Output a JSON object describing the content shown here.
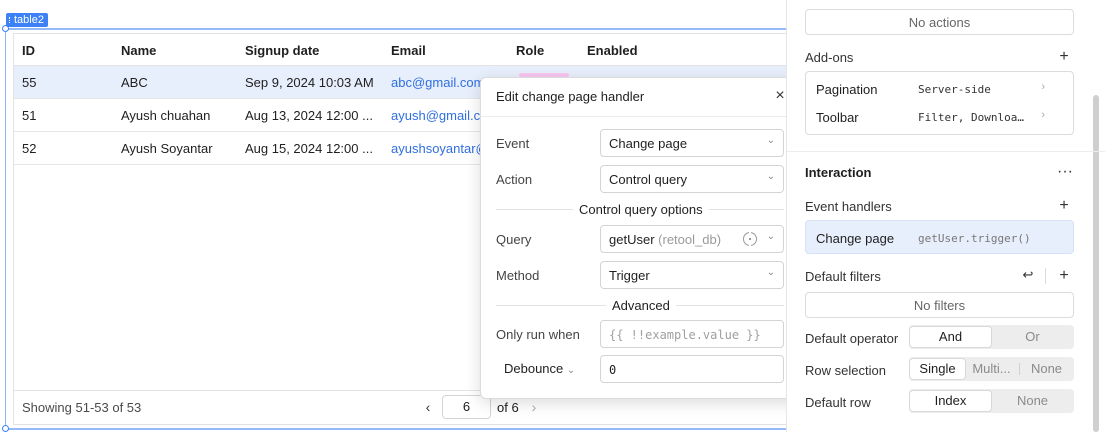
{
  "component_tag": "table2",
  "table": {
    "columns": [
      "ID",
      "Name",
      "Signup date",
      "Email",
      "Role",
      "Enabled"
    ],
    "rows": [
      {
        "id": "55",
        "name": "ABC",
        "signup": "Sep 9, 2024 10:03 AM",
        "email": "abc@gmail.com"
      },
      {
        "id": "51",
        "name": "Ayush chuahan",
        "signup": "Aug 13, 2024 12:00 ...",
        "email": "ayush@gmail.co"
      },
      {
        "id": "52",
        "name": "Ayush Soyantar",
        "signup": "Aug 15, 2024 12:00 ...",
        "email": "ayushsoyantar@"
      }
    ],
    "footer": {
      "showing": "Showing 51-53 of 53",
      "prev_icon": "‹",
      "page_value": "6",
      "of_total": "of 6",
      "next_icon": "›"
    }
  },
  "modal": {
    "title": "Edit change page handler",
    "close_icon": "×",
    "event_label": "Event",
    "event_value": "Change page",
    "action_label": "Action",
    "action_value": "Control query",
    "section_control": "Control query options",
    "query_label": "Query",
    "query_value": "getUser",
    "query_source": "(retool_db)",
    "method_label": "Method",
    "method_value": "Trigger",
    "section_advanced": "Advanced",
    "only_run_label": "Only run when",
    "only_run_placeholder": "{{ !!example.value }}",
    "debounce_label": "Debounce",
    "debounce_value": "0",
    "chevron_icon": "⌄"
  },
  "panel": {
    "actions_empty": "No actions",
    "addons_title": "Add-ons",
    "addons": [
      {
        "label": "Pagination",
        "value": "Server-side"
      },
      {
        "label": "Toolbar",
        "value": "Filter, Downloa…"
      }
    ],
    "interaction_title": "Interaction",
    "more_icon": "···",
    "event_handlers_title": "Event handlers",
    "event_handler": {
      "label": "Change page",
      "value": "getUser.trigger()"
    },
    "default_filters_title": "Default filters",
    "filters_empty": "No filters",
    "default_operator_label": "Default operator",
    "operator_options": [
      "And",
      "Or"
    ],
    "row_selection_label": "Row selection",
    "row_selection_options": [
      "Single",
      "Multi...",
      "None"
    ],
    "default_row_label": "Default row",
    "default_row_options": [
      "Index",
      "None"
    ],
    "plus_icon": "+",
    "chevron_right": "›",
    "undo_icon": "↩"
  }
}
